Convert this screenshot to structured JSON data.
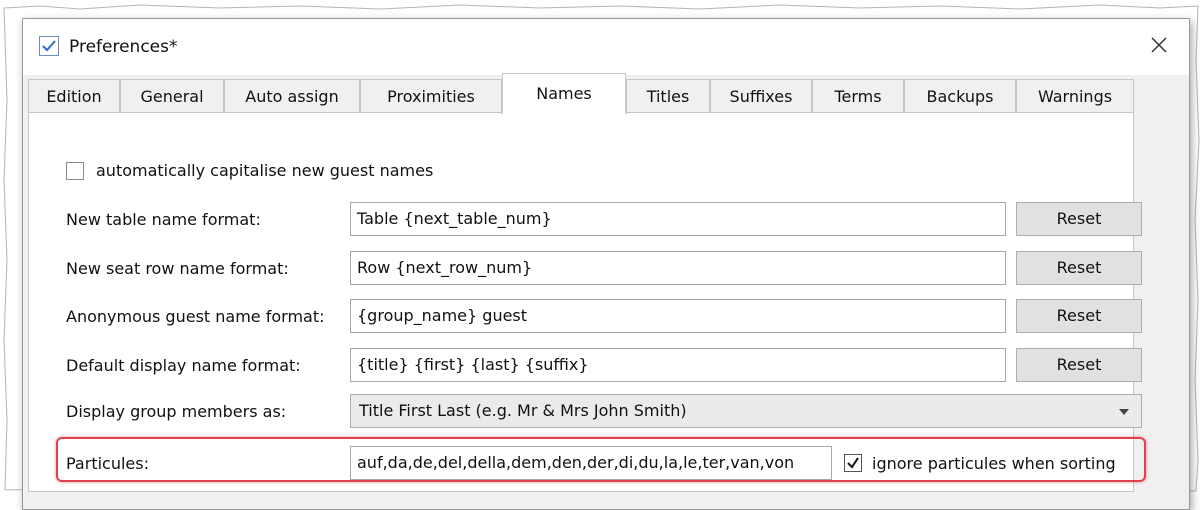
{
  "window": {
    "title": "Preferences*"
  },
  "icons": {
    "app": "checkmark-icon",
    "close": "close-icon",
    "dropdown": "chevron-down-icon"
  },
  "tabs": [
    {
      "label": "Edition",
      "active": false
    },
    {
      "label": "General",
      "active": false
    },
    {
      "label": "Auto assign",
      "active": false
    },
    {
      "label": "Proximities",
      "active": false
    },
    {
      "label": "Names",
      "active": true
    },
    {
      "label": "Titles",
      "active": false
    },
    {
      "label": "Suffixes",
      "active": false
    },
    {
      "label": "Terms",
      "active": false
    },
    {
      "label": "Backups",
      "active": false
    },
    {
      "label": "Warnings",
      "active": false
    }
  ],
  "names": {
    "auto_capitalise": {
      "label": "automatically capitalise new guest names",
      "checked": false
    },
    "table_format": {
      "label": "New table name format:",
      "value": "Table {next_table_num}",
      "reset": "Reset"
    },
    "seat_row_format": {
      "label": "New seat row name format:",
      "value": "Row {next_row_num}",
      "reset": "Reset"
    },
    "anon_guest_format": {
      "label": "Anonymous guest name format:",
      "value": "{group_name} guest",
      "reset": "Reset"
    },
    "display_name_format": {
      "label": "Default display name format:",
      "value": "{title} {first} {last} {suffix}",
      "reset": "Reset"
    },
    "group_members": {
      "label": "Display group members as:",
      "selected": "Title First Last (e.g. Mr & Mrs John Smith)"
    },
    "particules": {
      "label": "Particules:",
      "value": "auf,da,de,del,della,dem,den,der,di,du,la,le,ter,van,von",
      "ignore_label": "ignore particules when sorting",
      "ignore_checked": true
    }
  },
  "colors": {
    "highlight": "#e0424b",
    "accent": "#2b6cc4"
  }
}
